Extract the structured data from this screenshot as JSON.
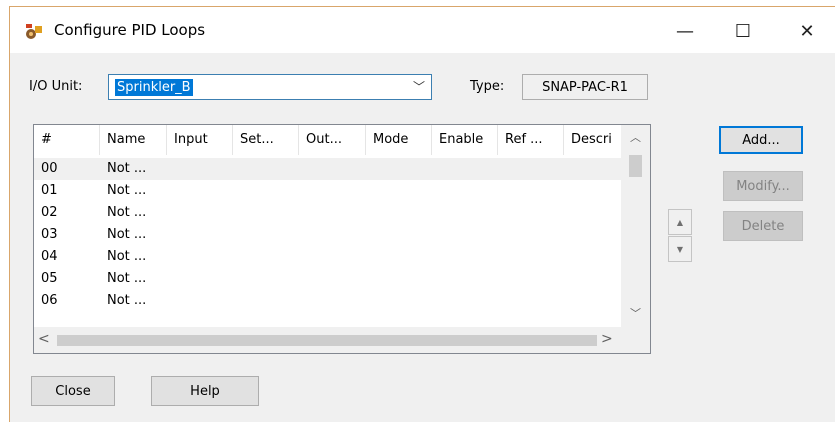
{
  "window": {
    "title": "Configure PID Loops",
    "minimize_glyph": "—",
    "maximize_glyph": "☐",
    "close_glyph": "✕"
  },
  "io_unit": {
    "label": "I/O Unit:",
    "value": "Sprinkler_B",
    "arrow": "﹀"
  },
  "type": {
    "label": "Type:",
    "value": "SNAP-PAC-R1"
  },
  "table": {
    "columns": [
      "#",
      "Name",
      "Input",
      "Set...",
      "Out...",
      "Mode",
      "Enable",
      "Ref ...",
      "Descri"
    ],
    "rows": [
      {
        "num": "00",
        "name": "Not ..."
      },
      {
        "num": "01",
        "name": "Not ..."
      },
      {
        "num": "02",
        "name": "Not ..."
      },
      {
        "num": "03",
        "name": "Not ..."
      },
      {
        "num": "04",
        "name": "Not ..."
      },
      {
        "num": "05",
        "name": "Not ..."
      },
      {
        "num": "06",
        "name": "Not ..."
      }
    ],
    "selected_row": 0
  },
  "buttons": {
    "add": "Add...",
    "modify": "Modify...",
    "delete": "Delete",
    "close": "Close",
    "help": "Help",
    "move_up": "▲",
    "move_down": "▼"
  },
  "colors": {
    "selection": "#0078d7",
    "window_bg": "#f0f0f0"
  }
}
